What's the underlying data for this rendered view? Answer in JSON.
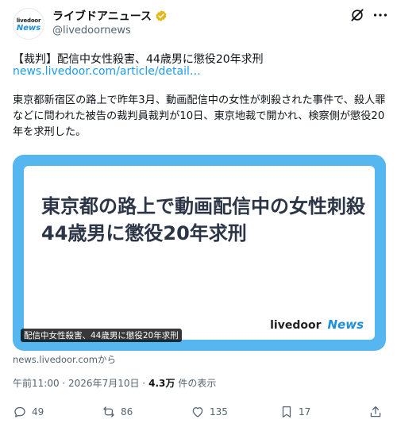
{
  "account": {
    "display_name": "ライブドアニュース",
    "handle": "@livedoornews",
    "avatar_top": "livedoor",
    "avatar_bottom": "News"
  },
  "post": {
    "title": "【裁判】配信中女性殺害、44歳男に懲役20年求刑",
    "link": "news.livedoor.com/article/detail…",
    "body": "東京都新宿区の路上で昨年3月、動画配信中の女性が刺殺された事件で、殺人罪などに問われた被告の裁判員裁判が10日、東京地裁で開かれ、検察側が懲役20年を求刑した。"
  },
  "card": {
    "headline": "東京都の路上で動画配信中の女性刺殺 44歳男に懲役20年求刑",
    "brand_main": "livedoor",
    "brand_news": "News",
    "caption": "配信中女性殺害、44歳男に懲役20年求刑",
    "source": "news.livedoor.comから",
    "accent_color": "#56b7f0"
  },
  "meta": {
    "timestamp": "午前11:00 · 2026年7月10日 ·",
    "views_count": "4.3万",
    "views_label": "件の表示"
  },
  "actions": {
    "replies": "49",
    "reposts": "86",
    "likes": "135",
    "bookmarks": "17"
  }
}
